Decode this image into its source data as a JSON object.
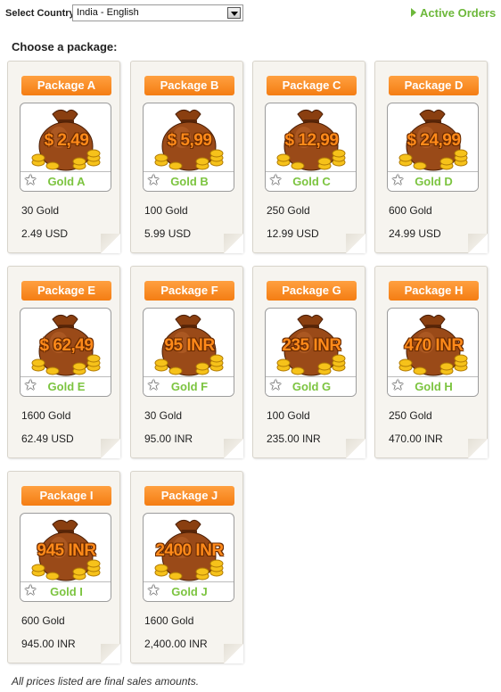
{
  "top": {
    "country_label": "Select Country",
    "country_value": "India - English",
    "active_orders": "Active Orders"
  },
  "choose_label": "Choose a package:",
  "packages": [
    {
      "label": "Package A",
      "overlay": "$ 2,49",
      "gold_name": "Gold A",
      "amount": "30 Gold",
      "price": "2.49 USD"
    },
    {
      "label": "Package B",
      "overlay": "$ 5,99",
      "gold_name": "Gold B",
      "amount": "100 Gold",
      "price": "5.99 USD"
    },
    {
      "label": "Package C",
      "overlay": "$ 12,99",
      "gold_name": "Gold C",
      "amount": "250 Gold",
      "price": "12.99 USD"
    },
    {
      "label": "Package D",
      "overlay": "$ 24,99",
      "gold_name": "Gold D",
      "amount": "600 Gold",
      "price": "24.99 USD"
    },
    {
      "label": "Package E",
      "overlay": "$ 62,49",
      "gold_name": "Gold E",
      "amount": "1600 Gold",
      "price": "62.49 USD"
    },
    {
      "label": "Package F",
      "overlay": "95 INR",
      "gold_name": "Gold F",
      "amount": "30 Gold",
      "price": "95.00 INR"
    },
    {
      "label": "Package G",
      "overlay": "235 INR",
      "gold_name": "Gold G",
      "amount": "100 Gold",
      "price": "235.00 INR"
    },
    {
      "label": "Package H",
      "overlay": "470 INR",
      "gold_name": "Gold H",
      "amount": "250 Gold",
      "price": "470.00 INR"
    },
    {
      "label": "Package I",
      "overlay": "945 INR",
      "gold_name": "Gold I",
      "amount": "600 Gold",
      "price": "945.00 INR"
    },
    {
      "label": "Package J",
      "overlay": "2400 INR",
      "gold_name": "Gold J",
      "amount": "1600 Gold",
      "price": "2,400.00 INR"
    }
  ],
  "footer_note": "All prices listed are final sales amounts.",
  "icons": {
    "star": "star-icon",
    "dropdown": "chevron-down-icon",
    "arrow": "triangle-right-icon"
  },
  "colors": {
    "accent_orange": "#f47d13",
    "link_green": "#6db83b",
    "gold_text": "#7cc440"
  }
}
